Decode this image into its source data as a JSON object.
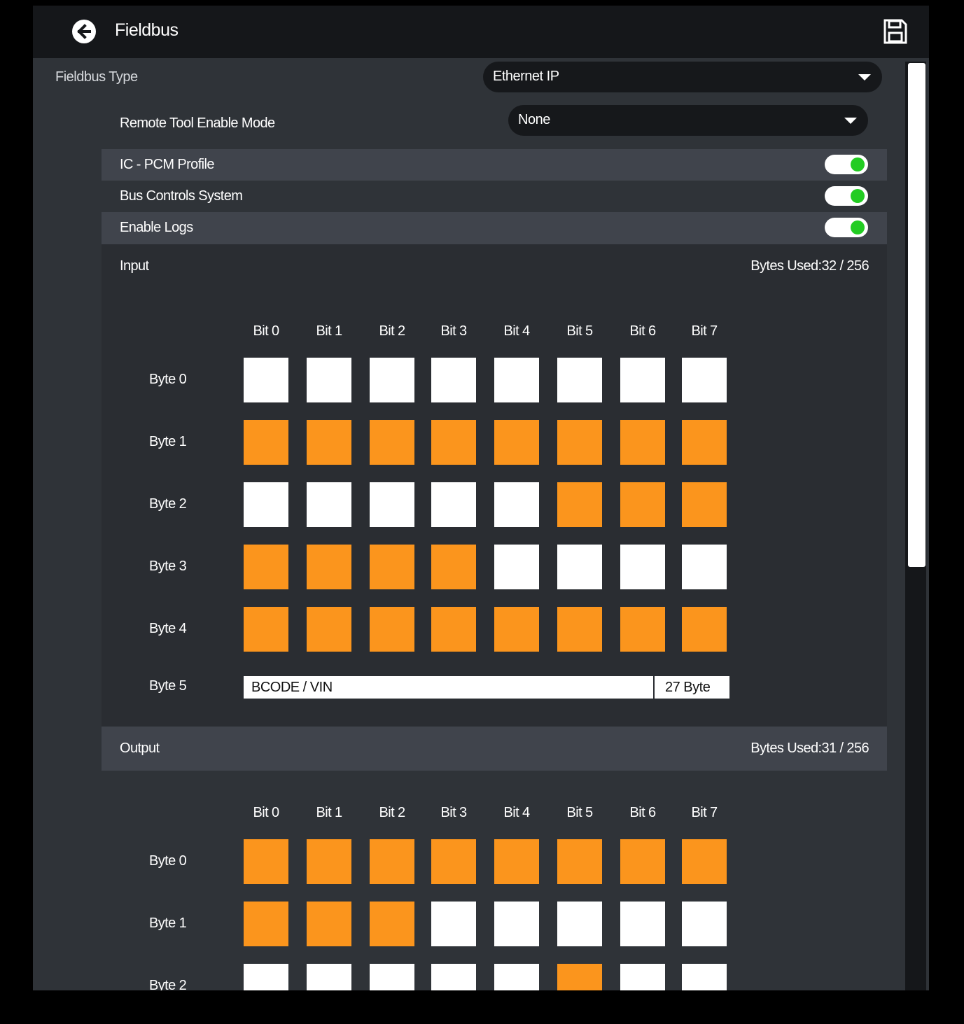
{
  "header": {
    "title": "Fieldbus",
    "back_icon": "arrow-left-circle-icon",
    "save_icon": "floppy-disk-icon"
  },
  "fieldbus_type": {
    "label": "Fieldbus Type",
    "value": "Ethernet IP"
  },
  "remote_tool": {
    "label": "Remote Tool Enable Mode",
    "value": "None"
  },
  "toggles": [
    {
      "label": "IC - PCM Profile",
      "on": true
    },
    {
      "label": "Bus Controls System",
      "on": true
    },
    {
      "label": "Enable Logs",
      "on": true
    }
  ],
  "colors": {
    "bit_on": "#fb951d",
    "bit_off": "#ffffff",
    "toggle_on": "#22cc22",
    "background": "#2f3338"
  },
  "input": {
    "title": "Input",
    "bytes_used": "Bytes Used:32 / 256",
    "bit_headers": [
      "Bit 0",
      "Bit 1",
      "Bit 2",
      "Bit 3",
      "Bit 4",
      "Bit 5",
      "Bit 6",
      "Bit 7"
    ],
    "bytes": [
      {
        "label": "Byte 0",
        "bits": [
          0,
          0,
          0,
          0,
          0,
          0,
          0,
          0
        ]
      },
      {
        "label": "Byte 1",
        "bits": [
          1,
          1,
          1,
          1,
          1,
          1,
          1,
          1
        ]
      },
      {
        "label": "Byte 2",
        "bits": [
          0,
          0,
          0,
          0,
          0,
          1,
          1,
          1
        ]
      },
      {
        "label": "Byte 3",
        "bits": [
          1,
          1,
          1,
          1,
          0,
          0,
          0,
          0
        ]
      },
      {
        "label": "Byte 4",
        "bits": [
          1,
          1,
          1,
          1,
          1,
          1,
          1,
          1
        ]
      }
    ],
    "extra_byte": {
      "label": "Byte 5",
      "name": "BCODE / VIN",
      "size": "27 Byte"
    }
  },
  "output": {
    "title": "Output",
    "bytes_used": "Bytes Used:31 / 256",
    "bit_headers": [
      "Bit 0",
      "Bit 1",
      "Bit 2",
      "Bit 3",
      "Bit 4",
      "Bit 5",
      "Bit 6",
      "Bit 7"
    ],
    "bytes": [
      {
        "label": "Byte 0",
        "bits": [
          1,
          1,
          1,
          1,
          1,
          1,
          1,
          1
        ]
      },
      {
        "label": "Byte 1",
        "bits": [
          1,
          1,
          1,
          0,
          0,
          0,
          0,
          0
        ]
      },
      {
        "label": "Byte 2",
        "bits": [
          0,
          0,
          0,
          0,
          0,
          1,
          0,
          0
        ]
      }
    ]
  }
}
